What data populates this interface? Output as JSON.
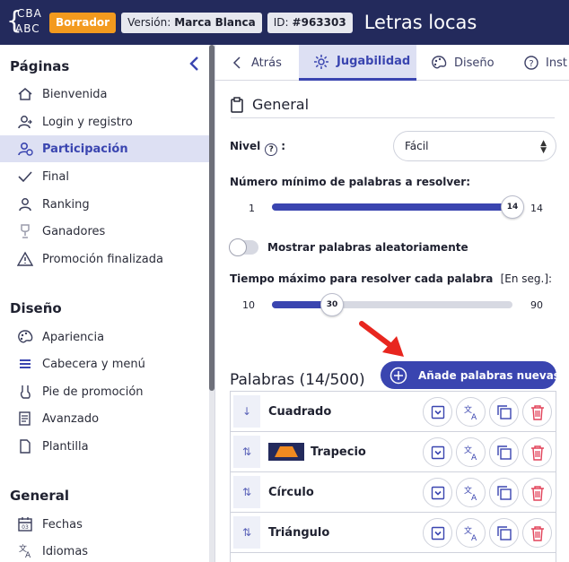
{
  "header": {
    "logo_line1": "CBA",
    "logo_line2": "ABC",
    "status_badge": "Borrador",
    "version_label": "Versión:",
    "version_value": "Marca Blanca",
    "id_label": "ID:",
    "id_value": "#963303",
    "app_title": "Letras locas",
    "colors": {
      "header_bg": "#232a5c",
      "draft": "#f39a1e",
      "accent": "#3a45b0"
    }
  },
  "sidebar": {
    "sections": [
      {
        "title": "Páginas",
        "items": [
          {
            "label": "Bienvenida",
            "icon": "home-icon"
          },
          {
            "label": "Login y registro",
            "icon": "login-icon"
          },
          {
            "label": "Participación",
            "icon": "participation-icon",
            "active": true
          },
          {
            "label": "Final",
            "icon": "check-icon"
          },
          {
            "label": "Ranking",
            "icon": "ranking-icon"
          },
          {
            "label": "Ganadores",
            "icon": "trophy-icon"
          },
          {
            "label": "Promoción finalizada",
            "icon": "warning-icon"
          }
        ]
      },
      {
        "title": "Diseño",
        "items": [
          {
            "label": "Apariencia",
            "icon": "palette-icon"
          },
          {
            "label": "Cabecera y menú",
            "icon": "menu-icon"
          },
          {
            "label": "Pie de promoción",
            "icon": "footer-icon"
          },
          {
            "label": "Avanzado",
            "icon": "advanced-icon"
          },
          {
            "label": "Plantilla",
            "icon": "template-icon"
          }
        ]
      },
      {
        "title": "General",
        "items": [
          {
            "label": "Fechas",
            "icon": "calendar-icon"
          },
          {
            "label": "Idiomas",
            "icon": "translate-icon"
          }
        ]
      }
    ]
  },
  "tabs": [
    {
      "label": "Atrás",
      "icon": "chevron-left-icon"
    },
    {
      "label": "Jugabilidad",
      "icon": "gear-icon",
      "active": true
    },
    {
      "label": "Diseño",
      "icon": "palette-icon"
    },
    {
      "label": "Inst",
      "icon": "help-icon"
    }
  ],
  "general": {
    "title": "General",
    "level_label": "Nivel",
    "level_colon": ":",
    "level_value": "Fácil",
    "min_words_label": "Número mínimo de palabras a resolver:",
    "min_words": {
      "min": "1",
      "max": "14",
      "value": "14",
      "fraction": 1.0
    },
    "random_toggle_label": "Mostrar palabras aleatoriamente",
    "random_toggle_on": false,
    "max_time_label": "Tiempo máximo para resolver cada palabra",
    "max_time_unit": "[En seg.]:",
    "max_time": {
      "min": "10",
      "max": "90",
      "value": "30",
      "fraction": 0.25
    }
  },
  "words": {
    "title": "Palabras (14/500)",
    "add_button": "Añade palabras nuevas",
    "rows": [
      {
        "name": "Cuadrado",
        "drag": "↓",
        "has_image": false
      },
      {
        "name": "Trapecio",
        "drag": "⇅",
        "has_image": true
      },
      {
        "name": "Círculo",
        "drag": "⇅",
        "has_image": false
      },
      {
        "name": "Triángulo",
        "drag": "⇅",
        "has_image": false
      }
    ]
  }
}
